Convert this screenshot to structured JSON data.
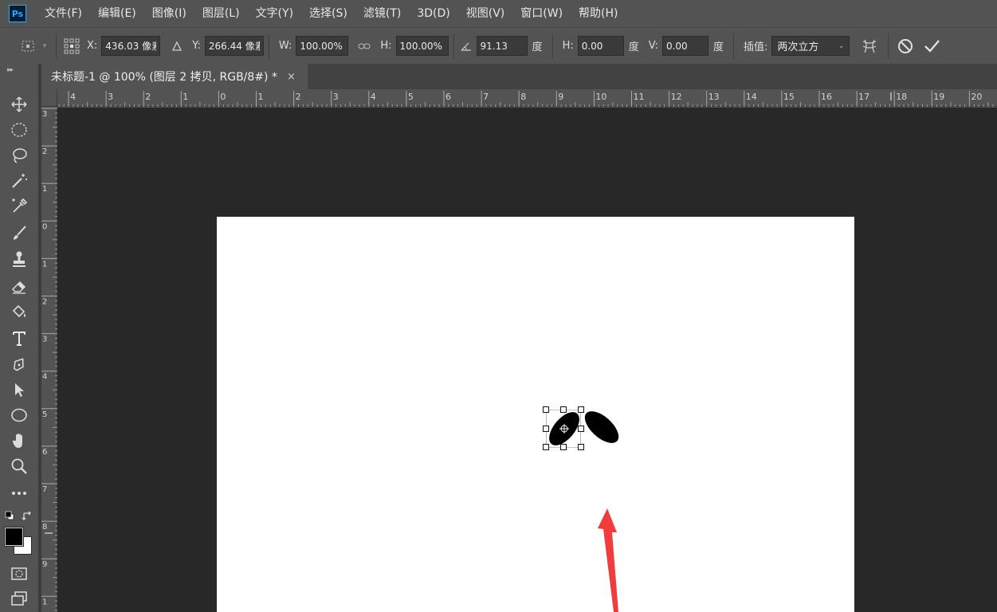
{
  "app": {
    "logo": "Ps"
  },
  "menu": [
    "文件(F)",
    "编辑(E)",
    "图像(I)",
    "图层(L)",
    "文字(Y)",
    "选择(S)",
    "滤镜(T)",
    "3D(D)",
    "视图(V)",
    "窗口(W)",
    "帮助(H)"
  ],
  "options": {
    "x_label": "X:",
    "x_value": "436.03 像素",
    "y_label": "Y:",
    "y_value": "266.44 像素",
    "w_label": "W:",
    "w_value": "100.00%",
    "h_label": "H:",
    "h_value": "100.00%",
    "angle_value": "91.13",
    "angle_unit": "度",
    "skew_h_label": "H:",
    "skew_h_value": "0.00",
    "skew_h_unit": "度",
    "skew_v_label": "V:",
    "skew_v_value": "0.00",
    "skew_v_unit": "度",
    "interp_label": "插值:",
    "interp_value": "两次立方"
  },
  "tab": {
    "title": "未标题-1 @ 100% (图层 2 拷贝, RGB/8#) *",
    "close": "×"
  },
  "ruler_h": [
    "4",
    "3",
    "2",
    "1",
    "0",
    "1",
    "2",
    "3",
    "4",
    "5",
    "6",
    "7",
    "8",
    "9",
    "10",
    "11",
    "12",
    "13",
    "14",
    "15",
    "16",
    "17",
    "18",
    "19",
    "20"
  ],
  "ruler_v": [
    "3",
    "2",
    "1",
    "0",
    "1",
    "2",
    "3",
    "4",
    "5",
    "6",
    "7",
    "8",
    "9",
    "1"
  ],
  "colors": {
    "foreground": "#000000",
    "background": "#ffffff",
    "arrow": "#f03c3c",
    "selection": "#31a8ff"
  },
  "tools": [
    "move-icon",
    "elliptical-marquee-icon",
    "lasso-icon",
    "magic-wand-icon",
    "eyedropper-icon",
    "brush-icon",
    "clone-stamp-icon",
    "eraser-icon",
    "paint-bucket-icon",
    "type-icon",
    "pen-icon",
    "path-selection-icon",
    "ellipse-icon",
    "hand-icon",
    "zoom-icon",
    "more-tools-icon",
    "quick-mask-icon",
    "screen-mode-icon"
  ]
}
